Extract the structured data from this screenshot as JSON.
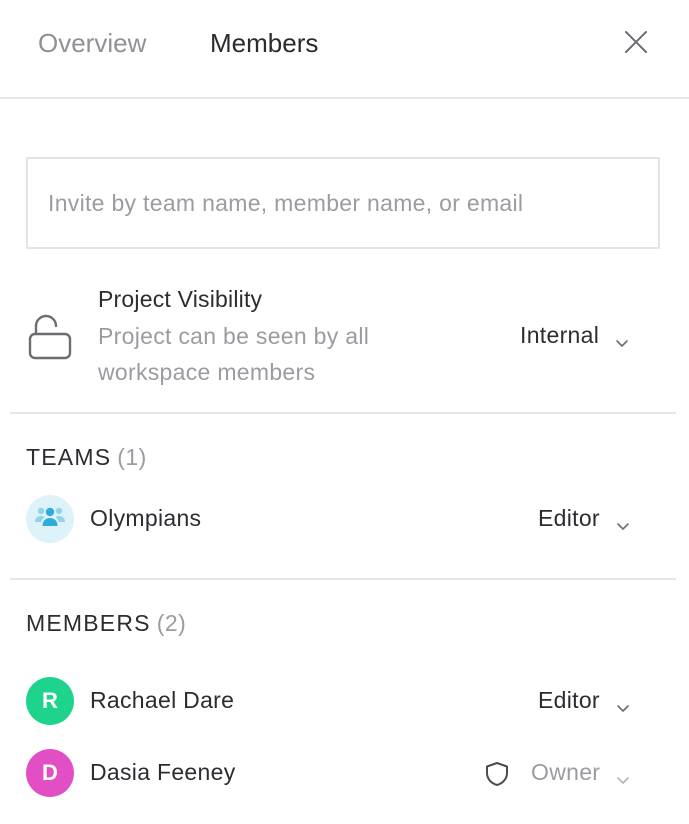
{
  "tabs": {
    "overview": "Overview",
    "members": "Members"
  },
  "icons": {
    "close": "close-icon",
    "lock": "lock-open-icon",
    "team": "team-icon",
    "shield": "shield-icon",
    "chevron": "chevron-down-icon"
  },
  "invite": {
    "placeholder": "Invite by team name, member name, or email",
    "value": ""
  },
  "visibility": {
    "title": "Project Visibility",
    "description": "Project can be seen by all workspace members",
    "value": "Internal"
  },
  "teams": {
    "label": "TEAMS",
    "count": "(1)",
    "items": [
      {
        "name": "Olympians",
        "role": "Editor",
        "avatar_color": "#def2fa",
        "icon_color": "#2eaddc"
      }
    ]
  },
  "members": {
    "label": "MEMBERS",
    "count": "(2)",
    "items": [
      {
        "initial": "R",
        "name": "Rachael Dare",
        "role": "Editor",
        "avatar_color": "#1ed48c"
      },
      {
        "initial": "D",
        "name": "Dasia Feeney",
        "role": "Owner",
        "avatar_color": "#e24fc4"
      }
    ]
  },
  "colors": {
    "divider": "#e6e6ea",
    "muted_text": "#9a9ca1",
    "primary_text": "#2b2d31"
  }
}
